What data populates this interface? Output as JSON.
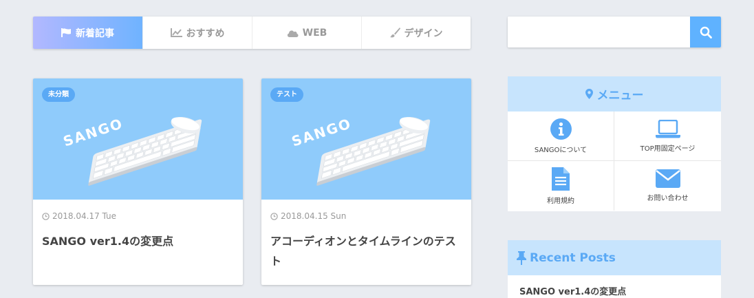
{
  "tabs": [
    {
      "label": "新着記事",
      "icon": "flag-icon"
    },
    {
      "label": "おすすめ",
      "icon": "chart-line-icon"
    },
    {
      "label": "WEB",
      "icon": "cloud-icon"
    },
    {
      "label": "デザイン",
      "icon": "brush-icon"
    }
  ],
  "search": {
    "placeholder": "",
    "icon": "search-icon"
  },
  "cards": [
    {
      "category": "未分類",
      "date": "2018.04.17 Tue",
      "title": "SANGO ver1.4の変更点",
      "logo": "SANGO"
    },
    {
      "category": "テスト",
      "date": "2018.04.15 Sun",
      "title": "アコーディオンとタイムラインのテスト",
      "logo": "SANGO"
    }
  ],
  "menu": {
    "title": "メニュー",
    "items": [
      {
        "label": "SANGOについて",
        "icon": "info-circle-icon"
      },
      {
        "label": "TOP用固定ページ",
        "icon": "laptop-icon"
      },
      {
        "label": "利用規約",
        "icon": "document-icon"
      },
      {
        "label": "お問い合わせ",
        "icon": "envelope-icon"
      }
    ]
  },
  "recent": {
    "title": "Recent Posts",
    "items": [
      "SANGO ver1.4の変更点"
    ]
  },
  "colors": {
    "accent": "#5aa9f5",
    "background": "#e9ecf1",
    "widget_header": "#c7e4fd",
    "card_image": "#8fcbfb"
  }
}
